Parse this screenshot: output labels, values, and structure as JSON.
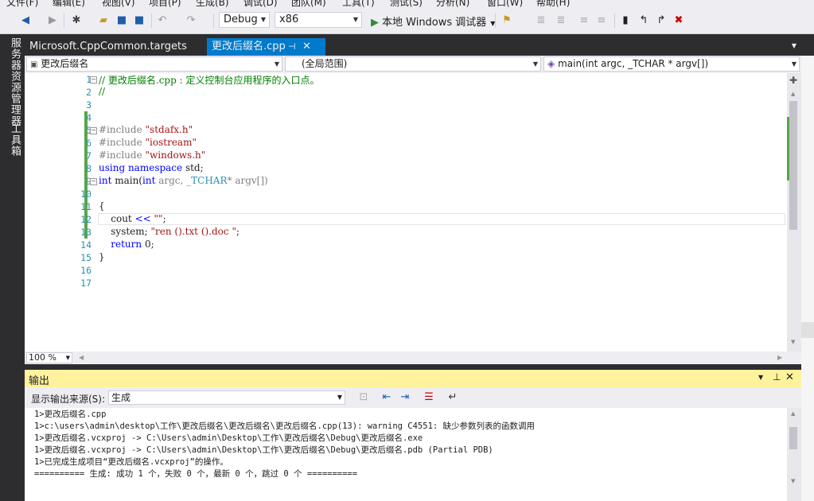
{
  "menu": [
    "文件(F)",
    "编辑(E)",
    "视图(V)",
    "项目(P)",
    "生成(B)",
    "调试(D)",
    "团队(M)",
    "工具(T)",
    "测试(S)",
    "分析(N)",
    "窗口(W)",
    "帮助(H)"
  ],
  "toolbar": {
    "config": "Debug",
    "platform": "x86",
    "run_label": "本地 Windows 调试器"
  },
  "left_tabs": [
    "服务器资源管理器",
    "工具箱"
  ],
  "tabs": [
    {
      "label": "Microsoft.CppCommon.targets"
    },
    {
      "label": "更改后缀名.cpp"
    }
  ],
  "navbar": {
    "project": "更改后缀名",
    "scope": "(全局范围)",
    "member": "main(int argc, _TCHAR * argv[])"
  },
  "editor": {
    "line_numbers": [
      "1",
      "2",
      "3",
      "4",
      "5",
      "6",
      "7",
      "8",
      "9",
      "10",
      "11",
      "12",
      "13",
      "14",
      "15",
      "16",
      "17"
    ],
    "lines": {
      "l1": "// 更改后缀名.cpp : 定义控制台应用程序的入口点。",
      "l2": "//",
      "l5a": "#include ",
      "l5b": "\"stdafx.h\"",
      "l6a": "#include ",
      "l6b": "\"iostream\"",
      "l7a": "#include ",
      "l7b": "\"windows.h\"",
      "l8a": "using namespace",
      "l8b": " std;",
      "l9a": "int",
      "l9b": " main(",
      "l9c": "int",
      "l9d": " argc, ",
      "l9e": "_TCHAR",
      "l9f": "* argv[])",
      "l11": "{",
      "l12a": "    cout ",
      "l12b": "<<",
      "l12c": " ",
      "l12d": "\"\"",
      "l12e": ";",
      "l13a": "    system; ",
      "l13b": "\"ren ().txt ().doc \"",
      "l13c": ";",
      "l14a": "    ",
      "l14b": "return",
      "l14c": " 0;",
      "l15": "}"
    },
    "zoom": "100 %"
  },
  "output": {
    "title": "输出",
    "source_label": "显示输出来源(S):",
    "source_value": "生成",
    "lines": [
      "1>更改后缀名.cpp",
      "1>c:\\users\\admin\\desktop\\工作\\更改后缀名\\更改后缀名\\更改后缀名.cpp(13): warning C4551: 缺少参数列表的函数调用",
      "1>更改后缀名.vcxproj -> C:\\Users\\admin\\Desktop\\工作\\更改后缀名\\Debug\\更改后缀名.exe",
      "1>更改后缀名.vcxproj -> C:\\Users\\admin\\Desktop\\工作\\更改后缀名\\Debug\\更改后缀名.pdb (Partial PDB)",
      "1>已完成生成项目“更改后缀名.vcxproj”的操作。",
      "========== 生成: 成功 1 个，失败 0 个，最新 0 个，跳过 0 个 =========="
    ]
  },
  "colors": {
    "accent": "#007acc",
    "output_header": "#fff29d",
    "change_bar": "#57a64a"
  }
}
